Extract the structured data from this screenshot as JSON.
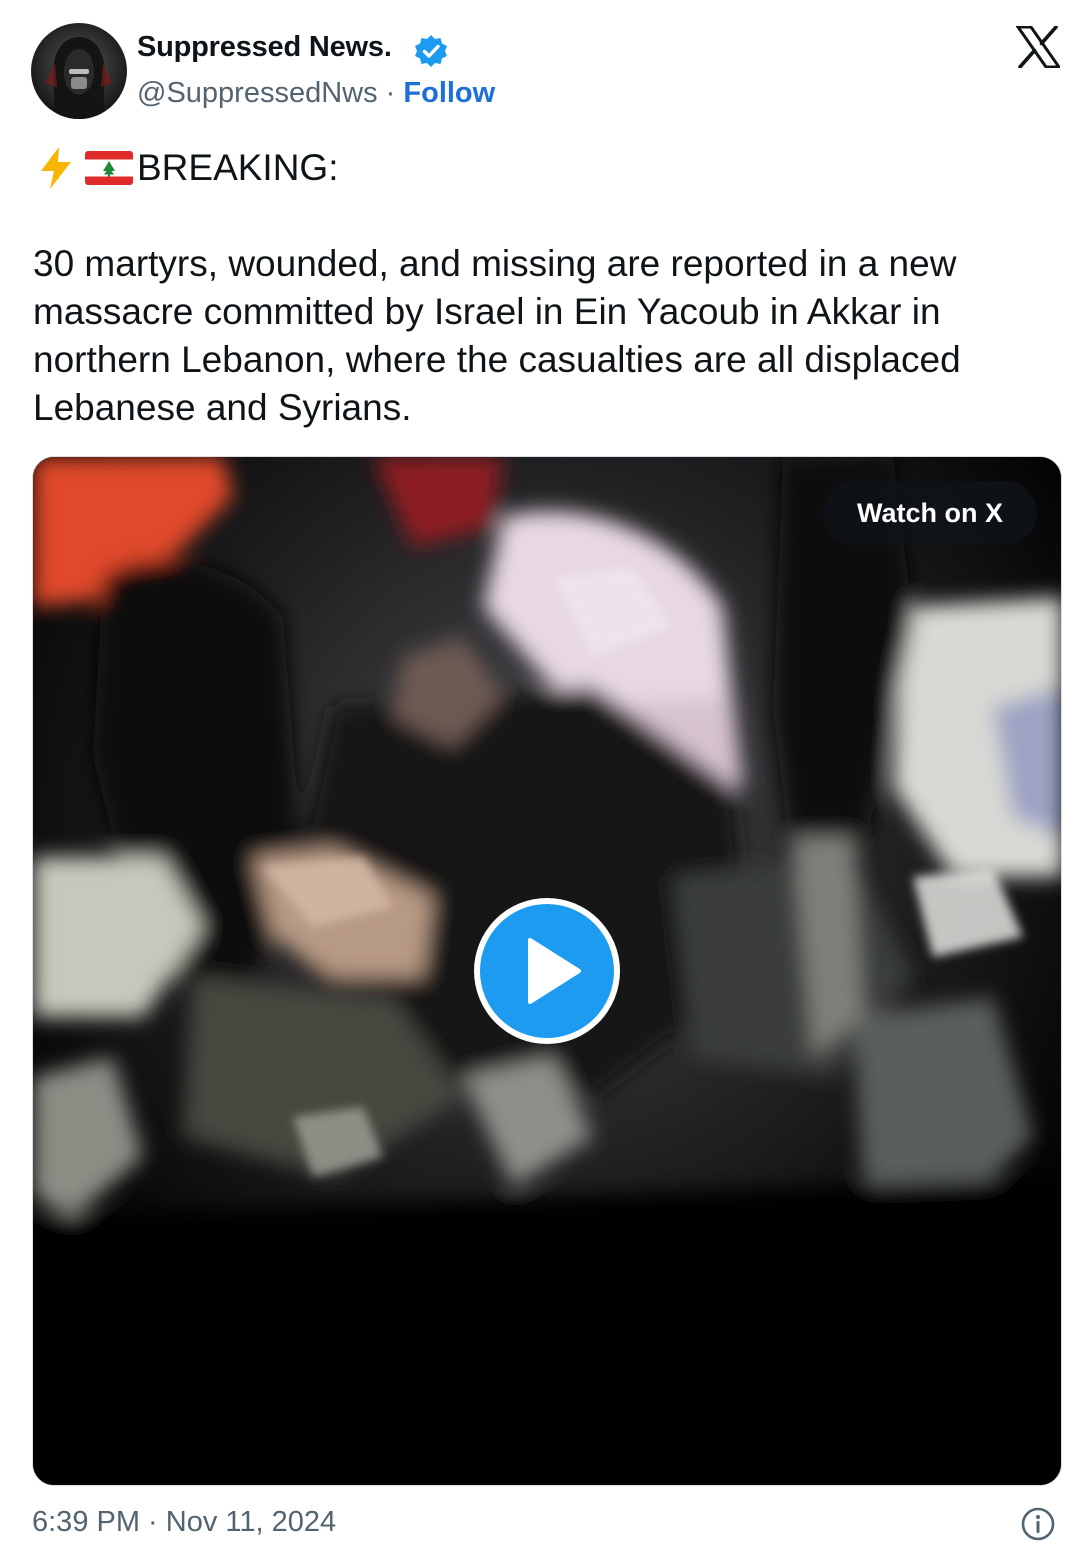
{
  "author": {
    "name": "Suppressed News.",
    "handle": "@SuppressedNws",
    "separator": "·",
    "follow_label": "Follow",
    "verified": true,
    "accent_color": "#1d9bf0"
  },
  "platform_icon": "x-logo-icon",
  "tweet": {
    "headline": "BREAKING:",
    "emoji_icons": [
      "lightning-bolt-icon",
      "lebanon-flag-icon"
    ],
    "body": "30 martyrs, wounded, and missing are reported in a new massacre committed by Israel in Ein Yacoub in Akkar in northern Lebanon, where the casualties are all displaced Lebanese and Syrians."
  },
  "media": {
    "type": "video",
    "watch_label": "Watch on X",
    "play_icon": "play-icon"
  },
  "footer": {
    "timestamp": "6:39 PM · Nov 11, 2024",
    "info_icon": "info-icon"
  }
}
